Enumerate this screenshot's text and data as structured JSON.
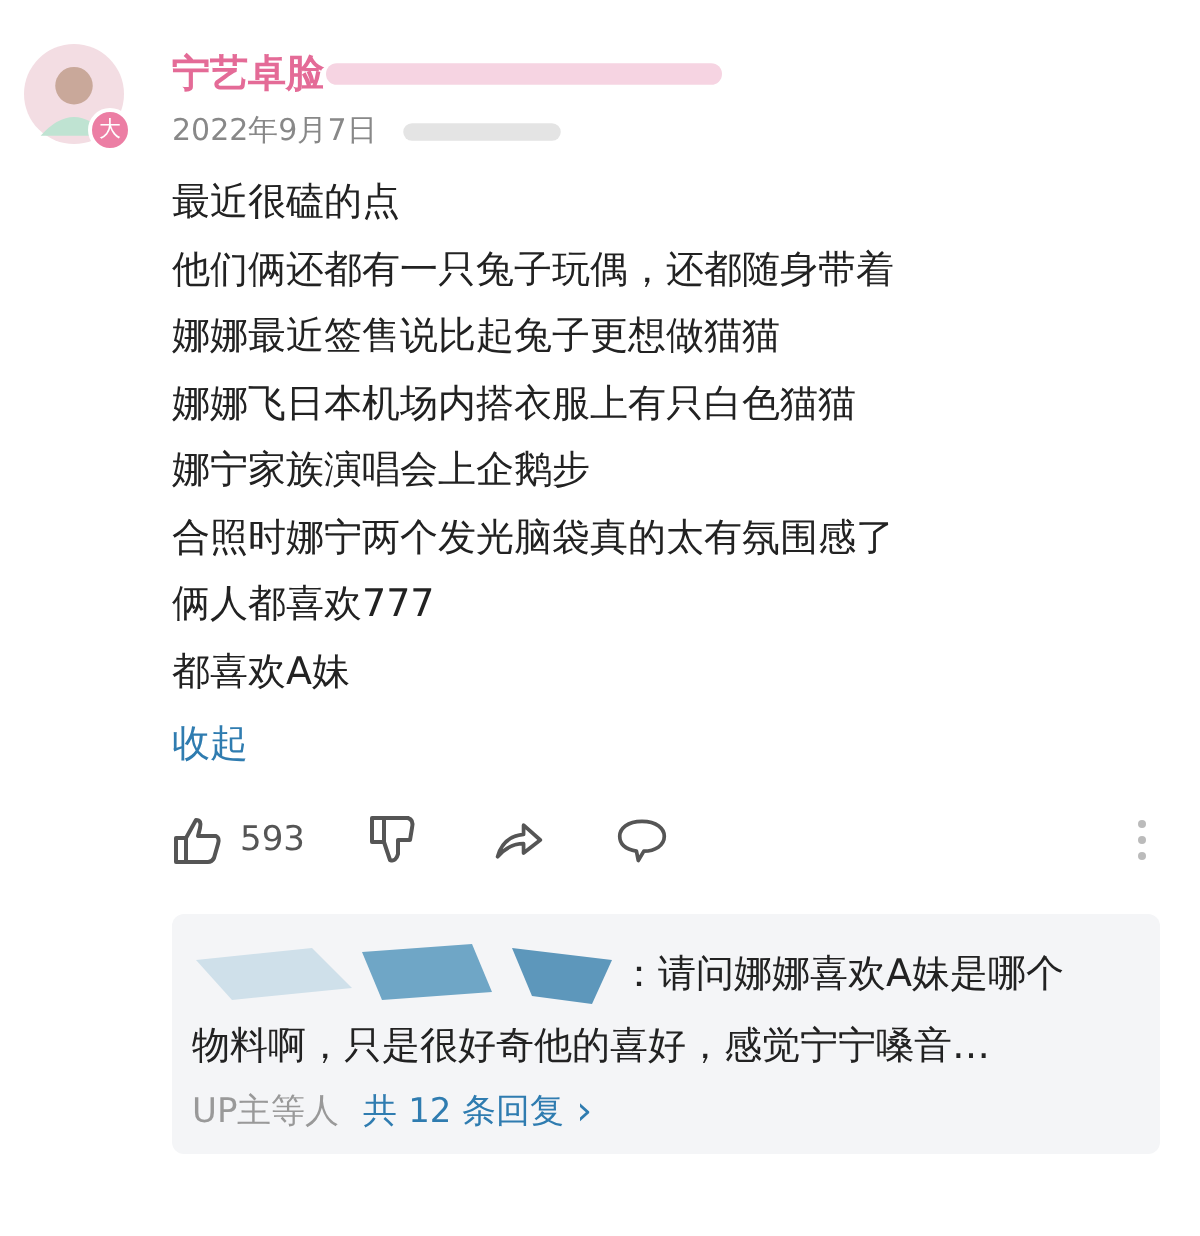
{
  "comment": {
    "username": "宁艺卓脸",
    "badge": "大",
    "date": "2022年9月7日",
    "lines": [
      "最近很磕的点",
      "他们俩还都有一只兔子玩偶，还都随身带着",
      "娜娜最近签售说比起兔子更想做猫猫",
      "娜娜飞日本机场内搭衣服上有只白色猫猫",
      "娜宁家族演唱会上企鹅步",
      "合照时娜宁两个发光脑袋真的太有氛围感了",
      "俩人都喜欢777",
      "都喜欢A妹"
    ],
    "collapse": "收起",
    "likes": "593"
  },
  "reply": {
    "lines": [
      "：请问娜娜喜欢A妹是哪个",
      "物料啊，只是很好奇他的喜好，感觉宁宁嗓音…"
    ],
    "repliers": "UP主等人",
    "count_link": "共 12 条回复",
    "chevron": "›"
  }
}
